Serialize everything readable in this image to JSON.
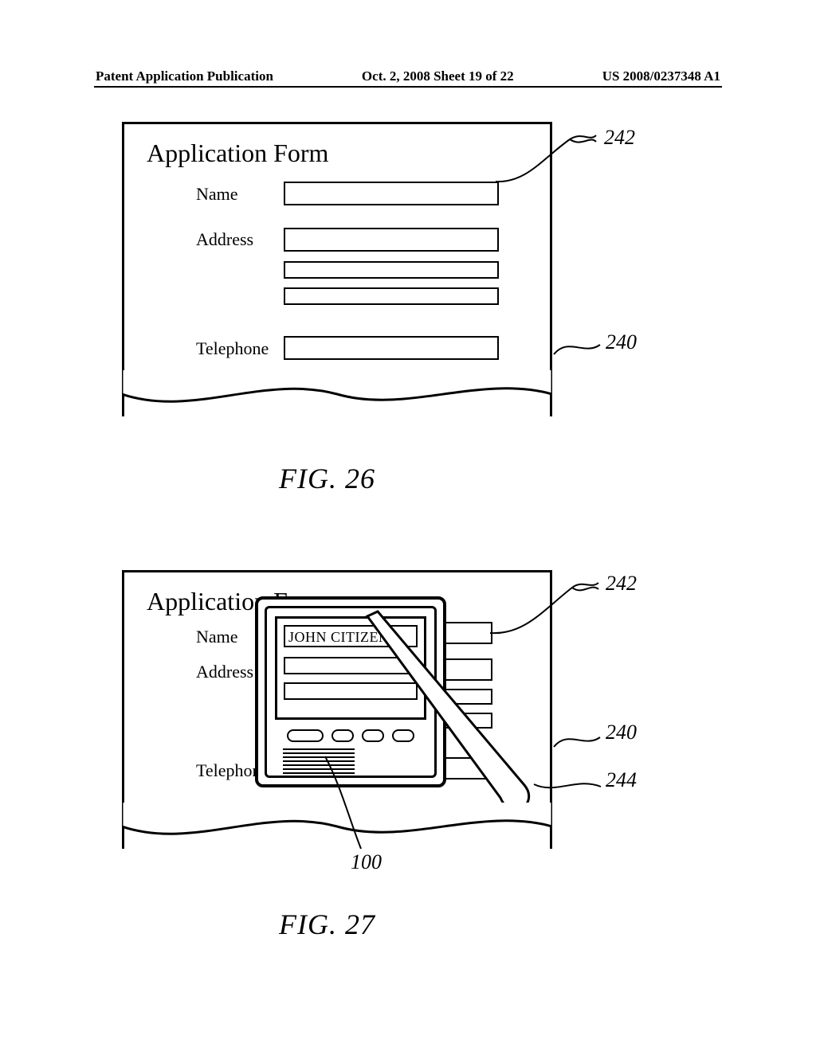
{
  "header": {
    "left": "Patent Application Publication",
    "center": "Oct. 2, 2008  Sheet 19 of 22",
    "right": "US 2008/0237348 A1"
  },
  "fig26": {
    "caption": "FIG. 26",
    "form_title": "Application Form",
    "labels": {
      "name": "Name",
      "address": "Address",
      "telephone": "Telephone"
    },
    "refs": {
      "field": "242",
      "form": "240"
    }
  },
  "fig27": {
    "caption": "FIG. 27",
    "form_title": "Application Form",
    "labels": {
      "name": "Name",
      "address": "Address",
      "telephone": "Telephon"
    },
    "device_name_value": "JOHN CITIZEN",
    "refs": {
      "field": "242",
      "form": "240",
      "stylus": "244",
      "device": "100"
    }
  }
}
